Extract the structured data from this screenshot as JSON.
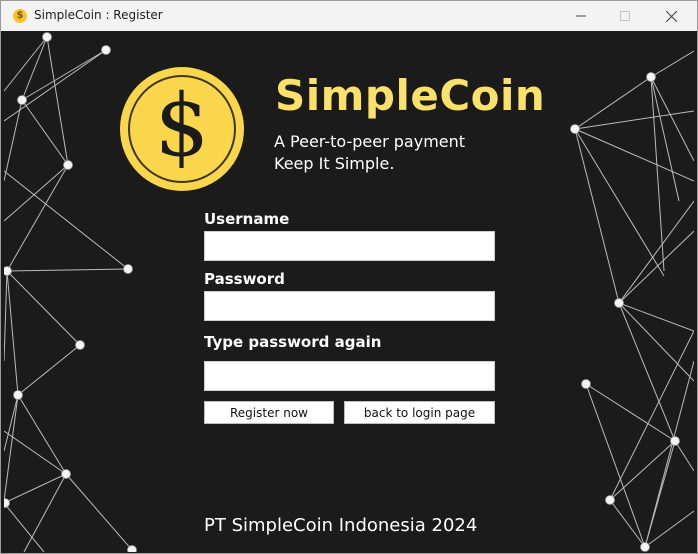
{
  "window": {
    "title": "SimpleCoin : Register"
  },
  "icons": {
    "app": "coin-icon",
    "minimize": "minimize-icon",
    "maximize": "maximize-icon",
    "close": "close-icon",
    "coin_symbol": "$"
  },
  "colors": {
    "brand": "#fbe06a",
    "coin": "#f9d64c",
    "background": "#1b1b1b"
  },
  "header": {
    "brand": "SimpleCoin",
    "tagline_line1": "A Peer-to-peer payment",
    "tagline_line2": "Keep It Simple."
  },
  "form": {
    "username_label": "Username",
    "password_label": "Password",
    "confirm_label": "Type password again",
    "username_value": "",
    "password_value": "",
    "confirm_value": ""
  },
  "buttons": {
    "register": "Register now",
    "back": "back to login page"
  },
  "footer": {
    "text": "PT SimpleCoin Indonesia 2024"
  }
}
